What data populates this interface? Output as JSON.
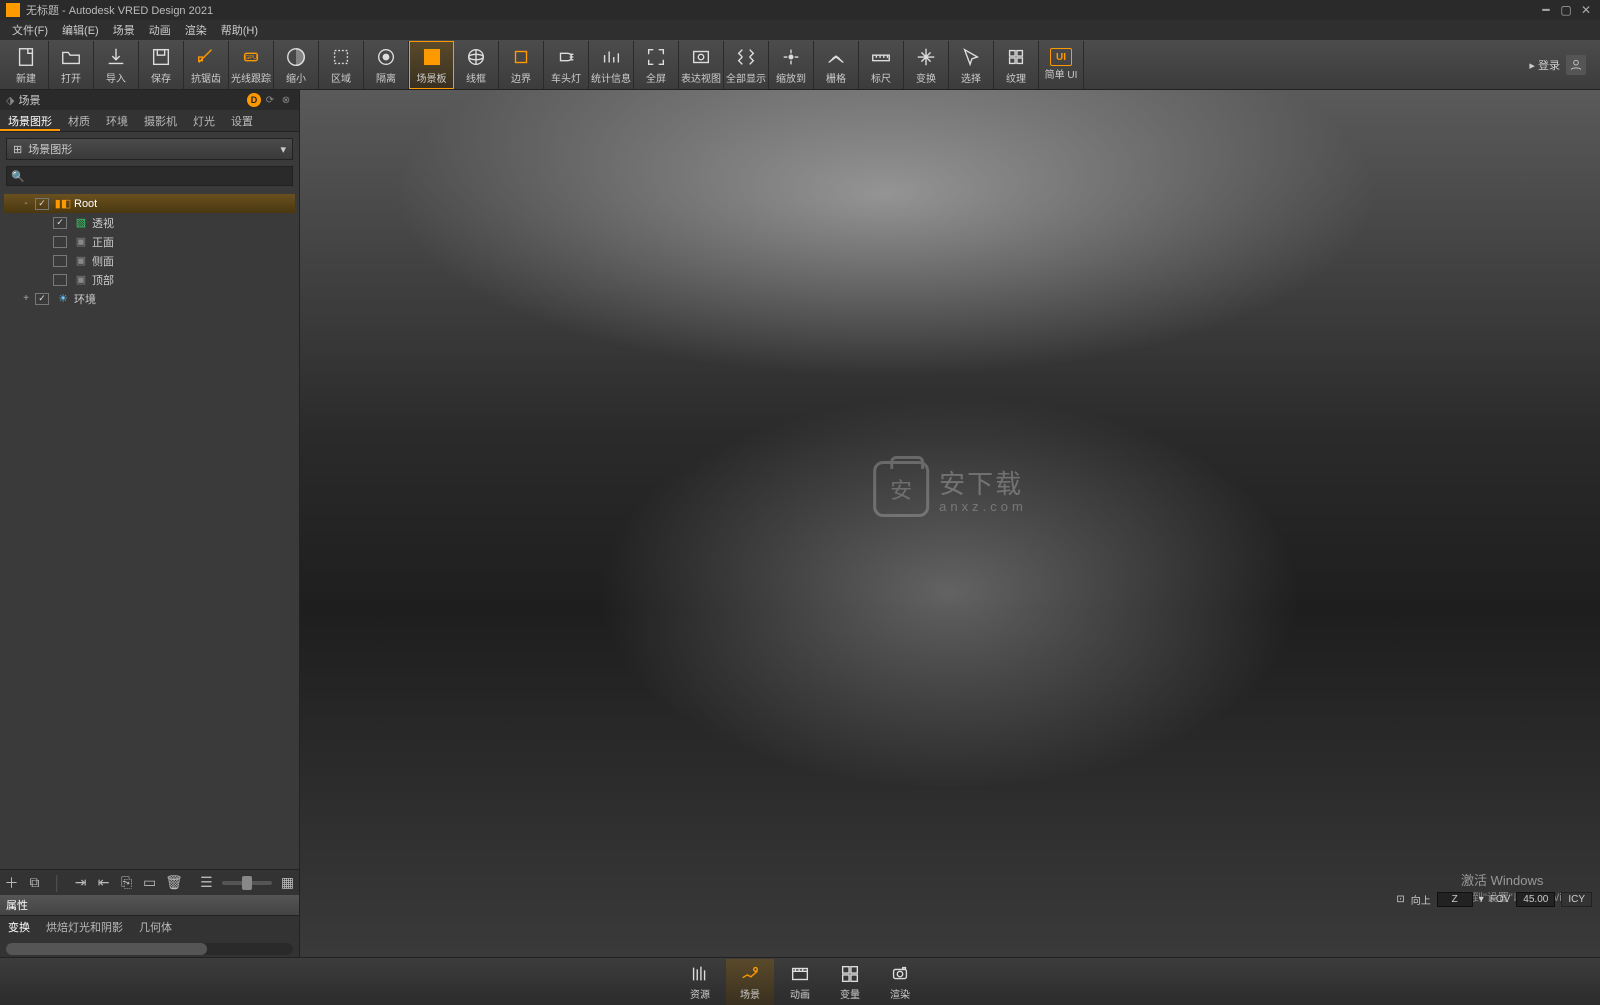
{
  "window": {
    "title": "无标题 - Autodesk VRED Design 2021"
  },
  "menu": {
    "items": [
      "文件(F)",
      "编辑(E)",
      "场景",
      "动画",
      "渲染",
      "帮助(H)"
    ]
  },
  "toolbar": {
    "buttons": [
      {
        "id": "new",
        "label": "新建"
      },
      {
        "id": "open",
        "label": "打开"
      },
      {
        "id": "import",
        "label": "导入"
      },
      {
        "id": "save",
        "label": "保存"
      },
      {
        "id": "antialias",
        "label": "抗锯齿",
        "highlight": true
      },
      {
        "id": "raytrace",
        "label": "光线跟踪",
        "highlight": true
      },
      {
        "id": "zoomout",
        "label": "缩小"
      },
      {
        "id": "region",
        "label": "区域"
      },
      {
        "id": "isolate",
        "label": "隔离"
      },
      {
        "id": "sceneboard",
        "label": "场景板",
        "active": true
      },
      {
        "id": "wireframe",
        "label": "线框"
      },
      {
        "id": "boundary",
        "label": "边界",
        "highlight": true
      },
      {
        "id": "headlight",
        "label": "车头灯"
      },
      {
        "id": "stats",
        "label": "统计信息"
      },
      {
        "id": "fullscreen",
        "label": "全屏"
      },
      {
        "id": "surfaceview",
        "label": "表达视图"
      },
      {
        "id": "showall",
        "label": "全部显示"
      },
      {
        "id": "zoomto",
        "label": "缩放到"
      },
      {
        "id": "grid",
        "label": "栅格"
      },
      {
        "id": "ruler",
        "label": "标尺"
      },
      {
        "id": "transform",
        "label": "变换"
      },
      {
        "id": "select",
        "label": "选择"
      },
      {
        "id": "texture",
        "label": "纹理"
      }
    ],
    "simpleui": {
      "label": "简单 UI",
      "badge": "UI"
    },
    "login": "▸ 登录"
  },
  "panel": {
    "title": "场景",
    "tabs": [
      "场景图形",
      "材质",
      "环境",
      "摄影机",
      "灯光",
      "设置"
    ],
    "activeTab": 0,
    "dropdown": "场景图形",
    "searchPlaceholder": "",
    "tree": [
      {
        "depth": 0,
        "exp": "-",
        "checked": true,
        "icon": "root",
        "label": "Root",
        "selected": true
      },
      {
        "depth": 1,
        "exp": "",
        "checked": true,
        "icon": "persp",
        "label": "透视"
      },
      {
        "depth": 1,
        "exp": "",
        "checked": false,
        "icon": "cam",
        "label": "正面"
      },
      {
        "depth": 1,
        "exp": "",
        "checked": false,
        "icon": "cam",
        "label": "侧面"
      },
      {
        "depth": 1,
        "exp": "",
        "checked": false,
        "icon": "cam",
        "label": "顶部"
      },
      {
        "depth": 0,
        "exp": "+",
        "checked": true,
        "icon": "env",
        "label": "环境"
      }
    ],
    "props": {
      "title": "属性",
      "tabs": [
        "变换",
        "烘焙灯光和阴影",
        "几何体"
      ],
      "activeTab": 0
    }
  },
  "bottombar": {
    "buttons": [
      {
        "id": "assets",
        "label": "资源"
      },
      {
        "id": "scene",
        "label": "场景",
        "active": true
      },
      {
        "id": "anim",
        "label": "动画"
      },
      {
        "id": "variant",
        "label": "变量"
      },
      {
        "id": "render",
        "label": "渲染"
      }
    ]
  },
  "statusbar": {
    "up": "向上",
    "axis": "Z",
    "fov_label": "FOV",
    "fov": "45.00",
    "icy": "ICY"
  },
  "watermark": {
    "l1": "安下载",
    "l2": "anxz.com",
    "an": "安"
  },
  "activate": {
    "l1": "激活 Windows",
    "l2": "转到\"设置\"以激活 Window"
  }
}
